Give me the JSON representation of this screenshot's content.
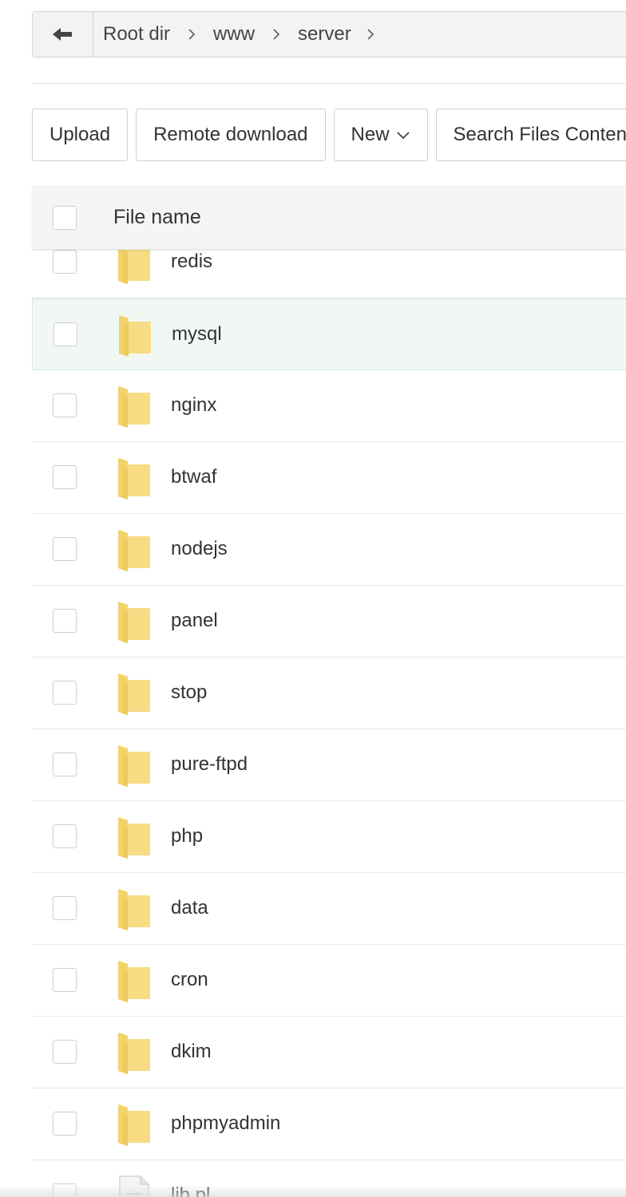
{
  "breadcrumb": {
    "items": [
      "Root dir",
      "www",
      "server"
    ]
  },
  "toolbar": {
    "upload_label": "Upload",
    "remote_download_label": "Remote download",
    "new_label": "New",
    "search_label": "Search Files Conten"
  },
  "table": {
    "column_file_name": "File name",
    "files": [
      {
        "name": "redis",
        "type": "folder"
      },
      {
        "name": "mysql",
        "type": "folder",
        "highlighted": true
      },
      {
        "name": "nginx",
        "type": "folder"
      },
      {
        "name": "btwaf",
        "type": "folder"
      },
      {
        "name": "nodejs",
        "type": "folder"
      },
      {
        "name": "panel",
        "type": "folder"
      },
      {
        "name": "stop",
        "type": "folder"
      },
      {
        "name": "pure-ftpd",
        "type": "folder"
      },
      {
        "name": "php",
        "type": "folder"
      },
      {
        "name": "data",
        "type": "folder"
      },
      {
        "name": "cron",
        "type": "folder"
      },
      {
        "name": "dkim",
        "type": "folder"
      },
      {
        "name": "phpmyadmin",
        "type": "folder"
      },
      {
        "name": "lib.pl",
        "type": "file"
      }
    ]
  },
  "colors": {
    "folder_yellow": "#f5d76e",
    "folder_dark": "#e8c14a",
    "highlight_row": "#f1f8f4",
    "border": "#cfcfcf"
  },
  "icons": {
    "back": "arrow-left-icon",
    "crumb_separator": "chevron-right-icon",
    "new_caret": "chevron-down-icon",
    "folder": "folder-icon",
    "file": "file-icon"
  }
}
